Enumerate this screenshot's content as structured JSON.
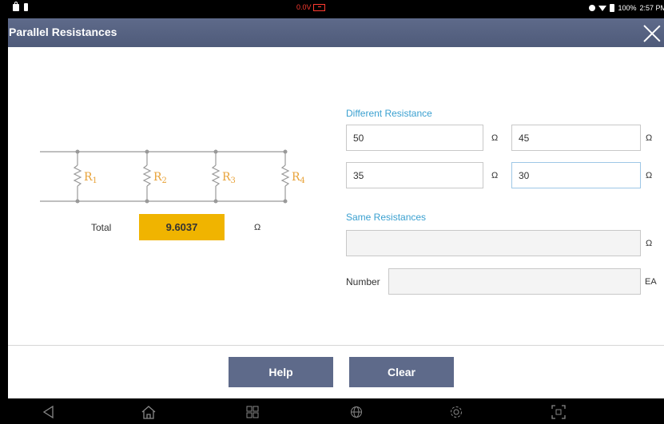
{
  "status_bar": {
    "voltage": "0.0V",
    "battery": "100%",
    "time": "2:57 PM"
  },
  "title": "Parallel Resistances",
  "circuit": {
    "resistors": [
      "R",
      "R",
      "R",
      "R"
    ],
    "subscripts": [
      "1",
      "2",
      "3",
      "4"
    ]
  },
  "total": {
    "label": "Total",
    "value": "9.6037",
    "unit": "Ω"
  },
  "different": {
    "heading": "Different Resistance",
    "fields": [
      {
        "value": "50",
        "unit": "Ω"
      },
      {
        "value": "45",
        "unit": "Ω"
      },
      {
        "value": "35",
        "unit": "Ω"
      },
      {
        "value": "30",
        "unit": "Ω"
      }
    ]
  },
  "same": {
    "heading": "Same Resistances",
    "value": "",
    "unit": "Ω",
    "number_label": "Number",
    "number_value": "",
    "number_unit": "EA"
  },
  "buttons": {
    "help": "Help",
    "clear": "Clear"
  },
  "nav_icons": [
    "back-icon",
    "home-icon",
    "recent-apps-icon",
    "globe-icon",
    "settings-icon",
    "screenshot-icon"
  ]
}
